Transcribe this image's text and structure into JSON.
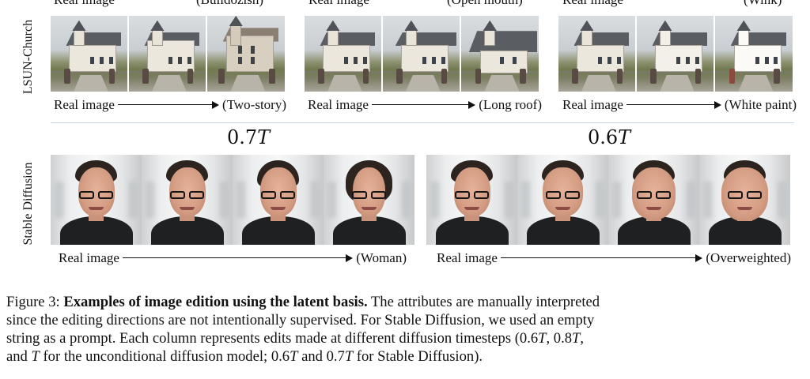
{
  "top_cutoff": {
    "group1_left": "Real image",
    "group1_right": "(Bulldozish)",
    "group2_left": "Real image",
    "group2_right": "(Open mouth)",
    "group3_left": "Real image",
    "group3_right": "(Wink)"
  },
  "rows": {
    "church_label": "LSUN-Church",
    "sd_label": "Stable Diffusion"
  },
  "church_groups": [
    {
      "left": "Real image",
      "right": "(Two-story)"
    },
    {
      "left": "Real image",
      "right": "(Long roof)"
    },
    {
      "left": "Real image",
      "right": "(White paint)"
    }
  ],
  "sd_groups": [
    {
      "timestep_value": "0.7",
      "timestep_symbol": "T",
      "left": "Real image",
      "right": "(Woman)"
    },
    {
      "timestep_value": "0.6",
      "timestep_symbol": "T",
      "left": "Real image",
      "right": "(Overweighted)"
    }
  ],
  "caption": {
    "prefix": "Figure 3: ",
    "title": "Examples of image edition using the latent basis.",
    "line1_rest": " The attributes are manually interpreted",
    "line2": "since the editing directions are not intentionally supervised. For Stable Diffusion, we used an empty",
    "line3a": "string as a prompt. Each column represents edits made at different diffusion timesteps (0.6",
    "T": "T",
    "comma": ", 0.8",
    "comma_end": ",",
    "line4a": "and ",
    "line4b": " for the unconditional diffusion model; 0.6",
    "and": " and 0.7",
    "line4c": " for Stable Diffusion)."
  }
}
